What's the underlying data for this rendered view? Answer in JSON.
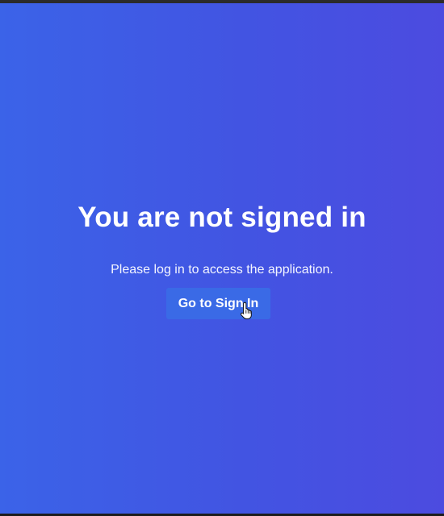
{
  "page": {
    "heading": "You are not signed in",
    "message": "Please log in to access the application.",
    "sign_in_label": "Go to Sign In"
  },
  "theme": {
    "gradient_start": "#3b63e8",
    "gradient_end": "#4c4be0",
    "button_color": "#3a6ae6",
    "text_color": "#ffffff"
  },
  "cursor": {
    "icon": "hand-pointer-icon"
  }
}
